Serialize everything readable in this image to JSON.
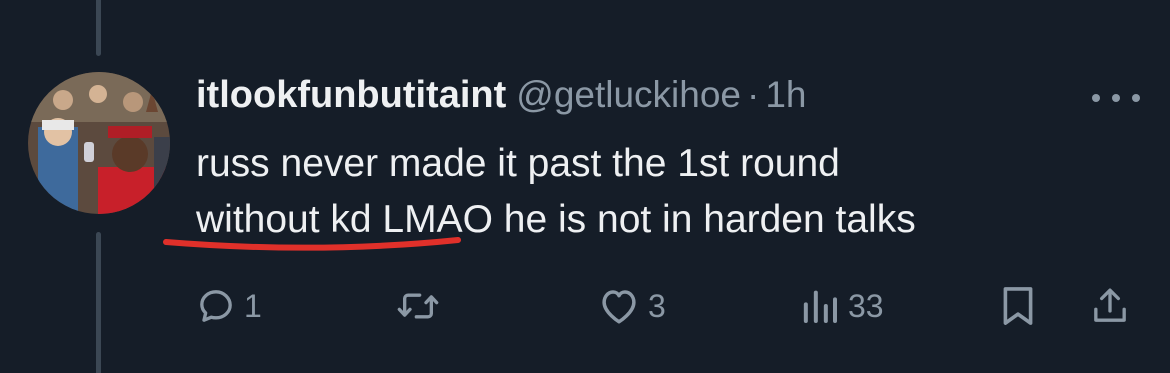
{
  "tweet": {
    "display_name": "itlookfunbutitaint",
    "handle": "@getluckihoe",
    "separator": "·",
    "time": "1h",
    "text_line1": "russ never made it past the 1st round",
    "text_line2": "without kd LMAO he is not in harden talks"
  },
  "actions": {
    "reply_count": "1",
    "retweet_count": "",
    "like_count": "3",
    "views_count": "33"
  },
  "colors": {
    "background": "#151d28",
    "text": "#eef0f2",
    "muted": "#8b98a5",
    "underline_annotation": "#e0302a"
  },
  "icons": [
    "reply-icon",
    "retweet-icon",
    "like-icon",
    "views-icon",
    "bookmark-icon",
    "share-icon",
    "more-icon"
  ]
}
